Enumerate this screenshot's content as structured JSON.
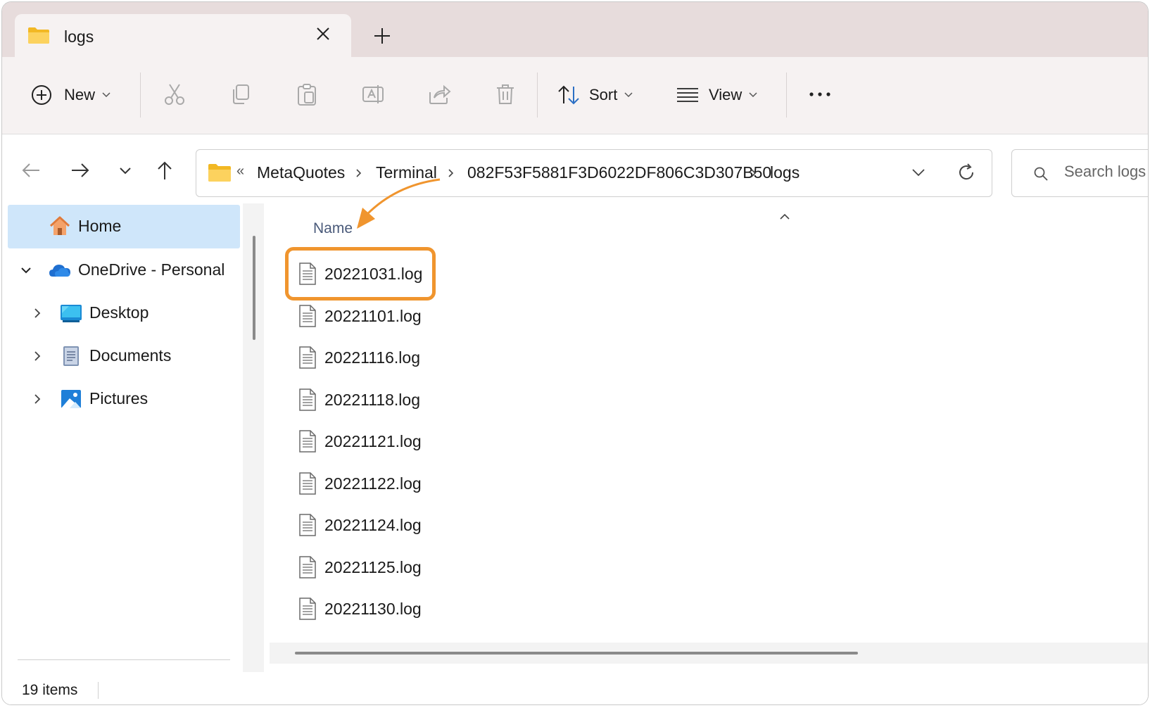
{
  "tab": {
    "title": "logs"
  },
  "toolbar": {
    "new_label": "New",
    "sort_label": "Sort",
    "view_label": "View"
  },
  "address": {
    "overflow": "«",
    "crumbs": [
      "MetaQuotes",
      "Terminal",
      "082F53F5881F3D6022DF806C3D307B50",
      "logs"
    ]
  },
  "search": {
    "placeholder": "Search logs"
  },
  "sidebar": {
    "items": [
      {
        "label": "Home",
        "icon": "home-icon",
        "selected": true
      },
      {
        "label": "OneDrive - Personal",
        "icon": "onedrive-icon",
        "expanded": true
      },
      {
        "label": "Desktop",
        "icon": "desktop-icon"
      },
      {
        "label": "Documents",
        "icon": "documents-icon"
      },
      {
        "label": "Pictures",
        "icon": "pictures-icon"
      }
    ]
  },
  "list": {
    "column_name": "Name",
    "files": [
      "20221031.log",
      "20221101.log",
      "20221116.log",
      "20221118.log",
      "20221121.log",
      "20221122.log",
      "20221124.log",
      "20221125.log",
      "20221130.log"
    ]
  },
  "status": {
    "items_count": "19 items"
  },
  "colors": {
    "highlight": "#f0952e",
    "selection": "#cfe6fa",
    "folder": "#f7c948"
  }
}
